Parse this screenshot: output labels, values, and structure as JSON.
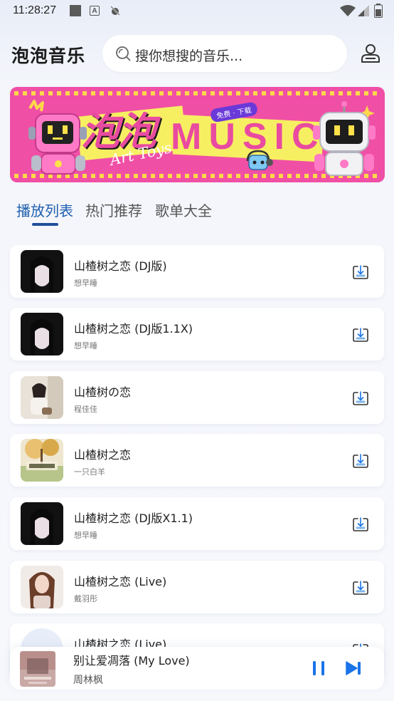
{
  "status_bar": {
    "time": "11:28:27",
    "a_icon": "A"
  },
  "header": {
    "title": "泡泡音乐",
    "search_placeholder": "搜你想搜的音乐..."
  },
  "banner": {
    "cn_text": "泡泡",
    "en_text": "MUSIC",
    "sub_text": "Art Toys",
    "badge": "免费 · 下载"
  },
  "tabs": [
    {
      "label": "播放列表",
      "active": true
    },
    {
      "label": "热门推荐",
      "active": false
    },
    {
      "label": "歌单大全",
      "active": false
    }
  ],
  "songs": [
    {
      "title": "山楂树之恋 (DJ版)",
      "artist": "想早睡"
    },
    {
      "title": "山楂树之恋 (DJ版1.1X)",
      "artist": "想早睡"
    },
    {
      "title": "山楂树の恋",
      "artist": "程佳佳"
    },
    {
      "title": "山楂树之恋",
      "artist": "一只白羊"
    },
    {
      "title": "山楂树之恋 (DJ版X1.1)",
      "artist": "想早睡"
    },
    {
      "title": "山楂树之恋 (Live)",
      "artist": "戴羽彤"
    },
    {
      "title": "山楂树之恋 (Live)",
      "artist": ""
    }
  ],
  "player": {
    "title": "别让爱凋落 (My Love)",
    "artist": "周林枫",
    "state": "playing"
  },
  "colors": {
    "accent": "#1f5fae",
    "player_icon": "#1a73e8",
    "banner_pink": "#f04fa6",
    "banner_yellow": "#f7ef62"
  },
  "icons": [
    "search-icon",
    "user-icon",
    "download-icon",
    "pause-icon",
    "next-icon",
    "wifi-icon",
    "signal-icon",
    "battery-icon"
  ]
}
